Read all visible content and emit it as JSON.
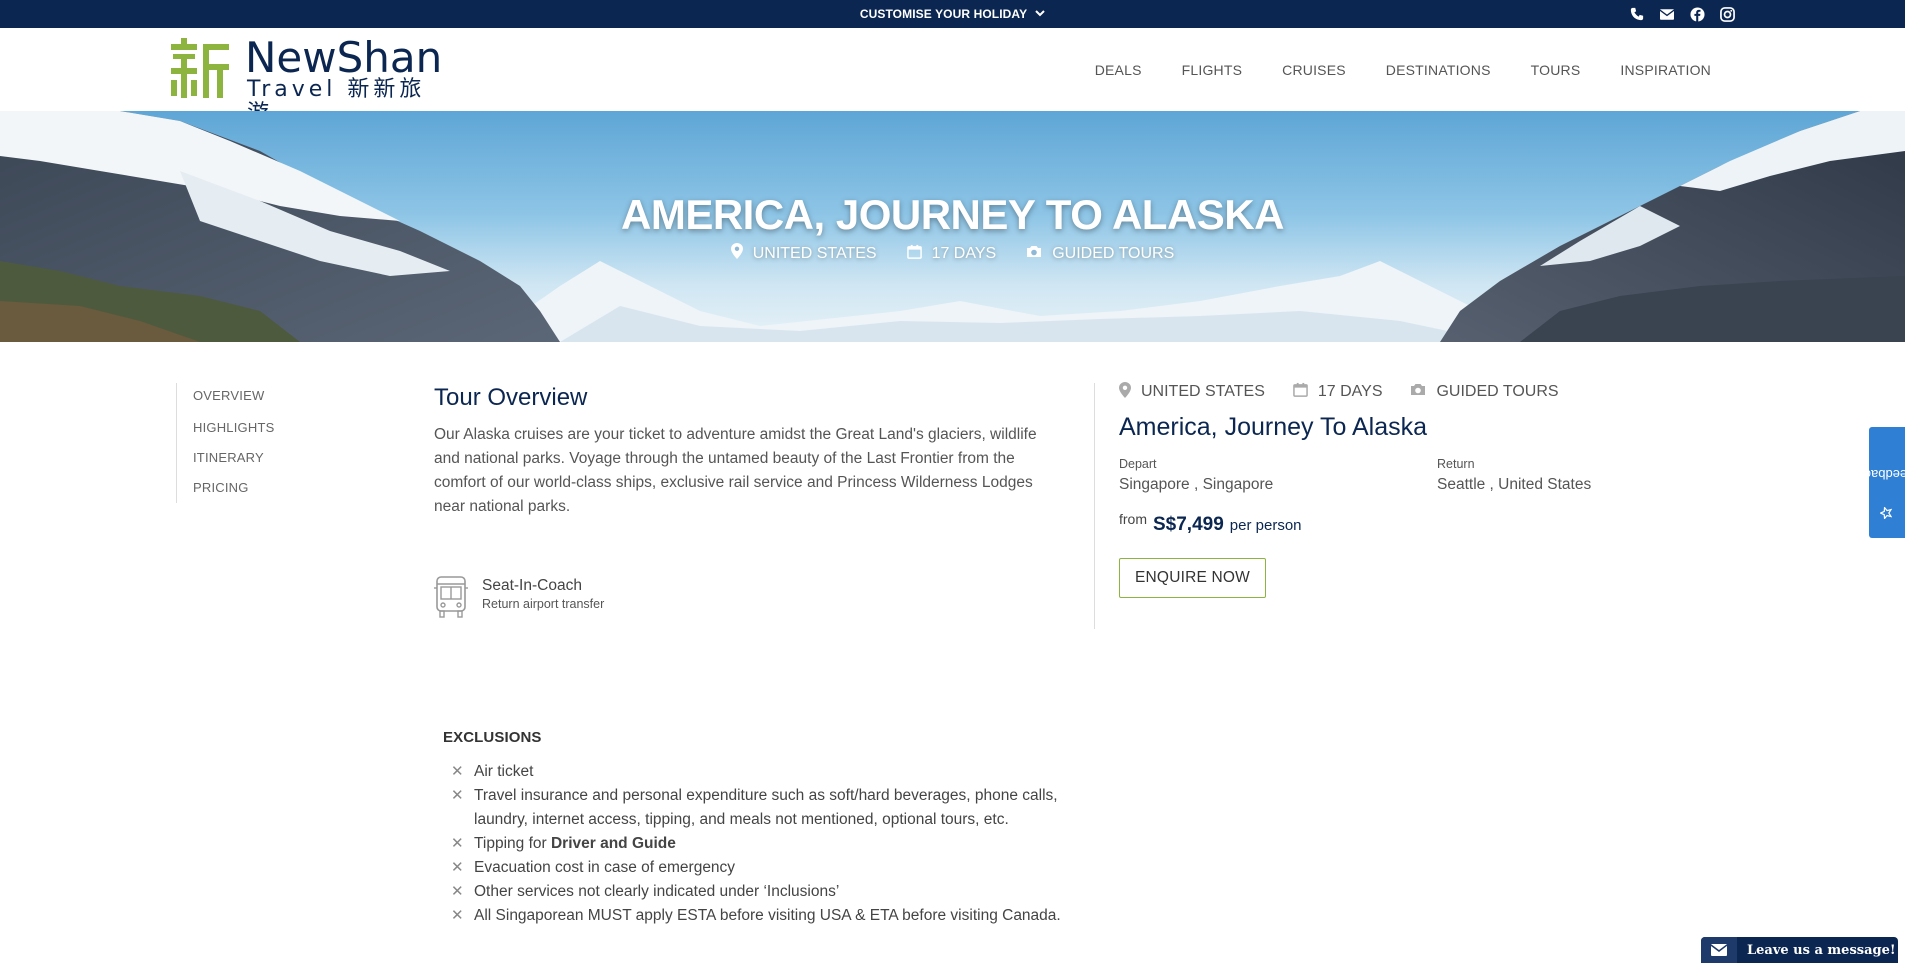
{
  "topbar": {
    "customise_label": "CUSTOMISE YOUR HOLIDAY",
    "chevron_glyph": "⌄",
    "social_icons": [
      "phone-icon",
      "mail-icon",
      "facebook-icon",
      "instagram-icon"
    ]
  },
  "header": {
    "logo_line1": "NewShan",
    "logo_line2": "Travel 新新旅游",
    "nav": [
      "DEALS",
      "FLIGHTS",
      "CRUISES",
      "DESTINATIONS",
      "TOURS",
      "INSPIRATION"
    ]
  },
  "hero": {
    "title": "AMERICA, JOURNEY TO ALASKA",
    "location": "UNITED STATES",
    "duration": "17 DAYS",
    "tour_type": "GUIDED TOURS"
  },
  "sidenav": [
    "OVERVIEW",
    "HIGHLIGHTS",
    "ITINERARY",
    "PRICING"
  ],
  "overview": {
    "heading": "Tour Overview",
    "body": "Our Alaska cruises are your ticket to adventure amidst the Great Land's glaciers, wildlife and national parks. Voyage through the untamed beauty of the Last Frontier from the comfort of our world-class ships, exclusive rail service and Princess Wilderness Lodges near national parks.",
    "feature_title": "Seat-In-Coach",
    "feature_sub": "Return airport transfer"
  },
  "panel": {
    "location": "UNITED STATES",
    "duration": "17 DAYS",
    "tour_type": "GUIDED TOURS",
    "title": "America, Journey To Alaska",
    "depart_label": "Depart",
    "depart_value": "Singapore , Singapore",
    "return_label": "Return",
    "return_value": "Seattle , United States",
    "price_from": "from",
    "price_amount": "S$7,499",
    "price_per": "per person",
    "enquire_label": "ENQUIRE NOW"
  },
  "exclusions": {
    "heading": "EXCLUSIONS",
    "items": [
      "Air ticket",
      "Travel insurance and personal expenditure such as soft/hard beverages, phone calls, laundry, internet access, tipping, and meals not mentioned, optional tours, etc.",
      "Tipping for ",
      "Evacuation cost in case of emergency",
      "Other services not clearly indicated under ‘Inclusions’",
      "All Singaporean MUST apply ESTA before visiting USA & ETA before visiting Canada."
    ],
    "item3_bold": "Driver and Guide"
  },
  "feedback_label": "Feedback",
  "message_label": "Leave us a message!",
  "colors": {
    "navy": "#0b2650",
    "green": "#8cb43f",
    "feedback_blue": "#2f7fd4"
  }
}
